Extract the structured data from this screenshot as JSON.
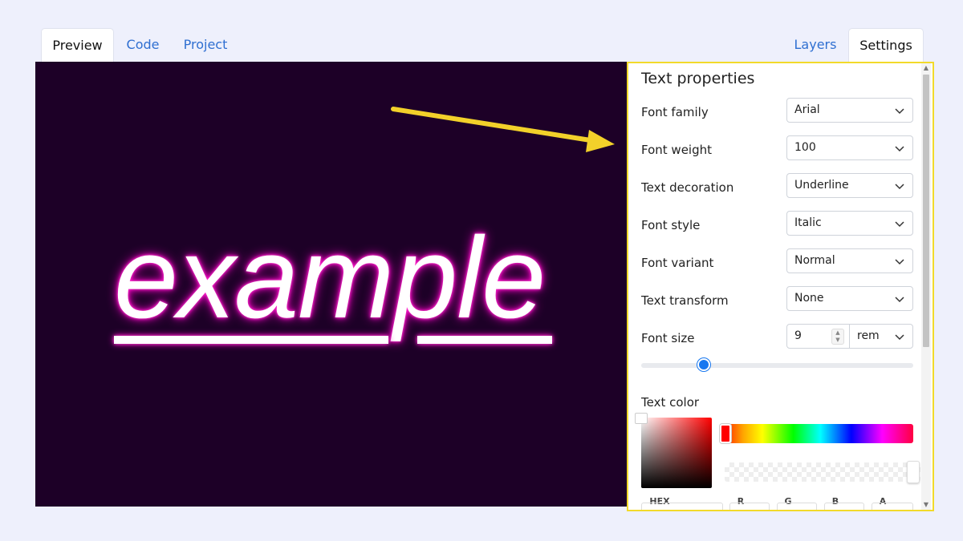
{
  "tabs_left": [
    "Preview",
    "Code",
    "Project"
  ],
  "tabs_right": [
    "Layers",
    "Settings"
  ],
  "preview": {
    "text": "example",
    "background": "#1d0027",
    "glow_color": "#ff00c8"
  },
  "panel": {
    "title": "Text properties",
    "rows": [
      {
        "label": "Font family",
        "value": "Arial"
      },
      {
        "label": "Font weight",
        "value": "100"
      },
      {
        "label": "Text decoration",
        "value": "Underline"
      },
      {
        "label": "Font style",
        "value": "Italic"
      },
      {
        "label": "Font variant",
        "value": "Normal"
      },
      {
        "label": "Text transform",
        "value": "None"
      }
    ],
    "font_size": {
      "label": "Font size",
      "value": "9",
      "unit": "rem",
      "slider_fraction": 0.23
    },
    "text_color": {
      "label": "Text color",
      "channels": [
        "HEX",
        "R",
        "G",
        "B",
        "A"
      ]
    }
  },
  "colors": {
    "accent": "#1677f0",
    "highlight_border": "#f2da2a",
    "arrow": "#f2d12a"
  }
}
